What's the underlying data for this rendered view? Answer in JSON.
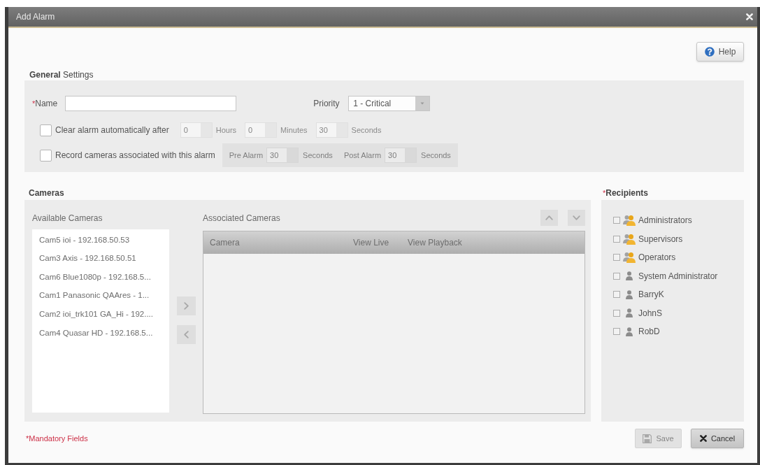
{
  "window": {
    "title": "Add Alarm"
  },
  "help_button": {
    "label": "Help"
  },
  "general_settings": {
    "heading": "**General** Settings",
    "name": {
      "required_mark": "*",
      "label": "Name"
    },
    "priority": {
      "label": "Priority",
      "value": "1 - Critical"
    },
    "clear_alarm": {
      "checked": false,
      "label": "Clear alarm automatically after",
      "durations": [
        {
          "value": "0",
          "unit": "Hours",
          "disabled": true
        },
        {
          "value": "0",
          "unit": "Minutes",
          "disabled": true
        },
        {
          "value": "30",
          "unit": "Seconds",
          "disabled": true
        }
      ]
    },
    "record_cameras": {
      "checked": false,
      "label": "Record cameras associated with this alarm",
      "timings": [
        {
          "label": "Pre Alarm",
          "value": "30",
          "unit": "Seconds",
          "disabled": true
        },
        {
          "label": "Post Alarm",
          "value": "30",
          "unit": "Seconds",
          "disabled": true
        }
      ]
    }
  },
  "cameras": {
    "heading": "Cameras",
    "available": {
      "label": "Available Cameras",
      "items": [
        "Cam5 ioi - 192.168.50.53",
        "Cam3 Axis - 192.168.50.51",
        "Cam6 Blue1080p - 192.168.5...",
        "Cam1 Panasonic QAAres - 1...",
        "Cam2 ioi_trk101 GA_Hi - 192....",
        "Cam4 Quasar HD - 192.168.5..."
      ]
    },
    "associated": {
      "label": "Associated Cameras",
      "columns": [
        "Camera",
        "View Live",
        "View Playback"
      ]
    }
  },
  "recipients": {
    "required_mark": "*",
    "heading": "Recipients",
    "items": [
      {
        "kind": "group",
        "label": "Administrators",
        "checked": false
      },
      {
        "kind": "group",
        "label": "Supervisors",
        "checked": false
      },
      {
        "kind": "group",
        "label": "Operators",
        "checked": false
      },
      {
        "kind": "user",
        "label": "System Administrator",
        "checked": false
      },
      {
        "kind": "user",
        "label": "BarryK",
        "checked": false
      },
      {
        "kind": "user",
        "label": "JohnS",
        "checked": false
      },
      {
        "kind": "user",
        "label": "RobD",
        "checked": false
      }
    ]
  },
  "footer": {
    "note": "*Mandatory Fields",
    "buttons": [
      {
        "kind": "save",
        "label": "Save",
        "disabled": true
      },
      {
        "kind": "cancel",
        "label": "Cancel",
        "disabled": false
      }
    ]
  }
}
